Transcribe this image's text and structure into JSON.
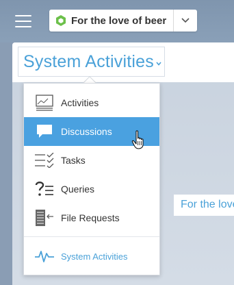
{
  "topbar": {
    "menu_icon": "hamburger-icon",
    "group": {
      "icon": "hexagon-icon",
      "name": "For the love of beer",
      "caret_icon": "chevron-down-icon"
    }
  },
  "activity_selector": {
    "title": "System Activities",
    "caret_icon": "caret-down-icon"
  },
  "background_text": "For the love",
  "dropdown": {
    "items": [
      {
        "label": "Activities",
        "icon": "activity-feed-icon"
      },
      {
        "label": "Discussions",
        "icon": "speech-bubble-icon",
        "selected": true
      },
      {
        "label": "Tasks",
        "icon": "checklist-icon"
      },
      {
        "label": "Queries",
        "icon": "question-list-icon"
      },
      {
        "label": "File Requests",
        "icon": "file-request-icon"
      }
    ],
    "footer": {
      "label": "System Activities",
      "icon": "pulse-icon"
    }
  },
  "colors": {
    "accent": "#4aa1d8",
    "selected_bg": "#4aa1e0",
    "hexagon": "#6cc04a",
    "topbar": "#8297b0"
  }
}
